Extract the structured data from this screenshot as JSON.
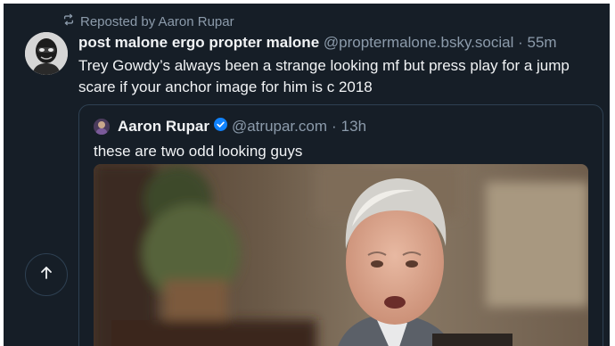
{
  "repost": {
    "label": "Reposted by Aaron Rupar"
  },
  "post": {
    "author_name": "post malone ergo propter malone",
    "handle": "@proptermalone.bsky.social",
    "separator": "·",
    "time": "55m",
    "text": "Trey Gowdy’s always been a strange looking mf but press play for a jump scare if your anchor image for him is c 2018"
  },
  "quote": {
    "author_name": "Aaron Rupar",
    "handle": "@atrupar.com",
    "separator": "·",
    "time": "13h",
    "text": "these are two odd looking guys",
    "verified": true
  },
  "colors": {
    "background": "#161e27",
    "primary_text": "#f1f3f5",
    "secondary_text": "#8c9bab",
    "border": "#2e4052",
    "verified_badge": "#1083fe"
  },
  "icons": {
    "repost": "repost-icon",
    "verified": "verified-badge-icon",
    "scroll_top": "arrow-up-icon"
  }
}
